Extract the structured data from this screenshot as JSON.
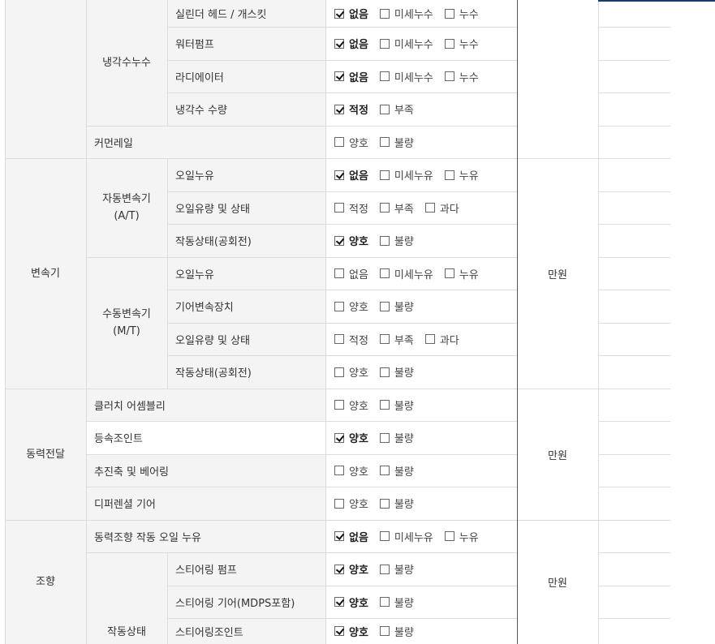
{
  "unit_label": "만원",
  "sections": [
    {
      "id": "engine-cont",
      "label": "",
      "unit": "",
      "subgroups": [
        {
          "label": "냉각수누수",
          "items": [
            {
              "label": "실린더 헤드 / 개스킷",
              "options": [
                "없음",
                "미세누수",
                "누수"
              ],
              "checked": [
                0
              ]
            },
            {
              "label": "워터펌프",
              "options": [
                "없음",
                "미세누수",
                "누수"
              ],
              "checked": [
                0
              ]
            },
            {
              "label": "라디에이터",
              "options": [
                "없음",
                "미세누수",
                "누수"
              ],
              "checked": [
                0
              ]
            },
            {
              "label": "냉각수 수량",
              "options": [
                "적정",
                "부족"
              ],
              "checked": [
                0
              ]
            }
          ]
        },
        {
          "label": "커먼레일",
          "single": true,
          "items": [
            {
              "label": "커먼레일",
              "options": [
                "양호",
                "불량"
              ],
              "checked": []
            }
          ]
        }
      ]
    },
    {
      "id": "transmission",
      "label": "변속기",
      "unit": "만원",
      "subgroups": [
        {
          "label": "자동변속기 (A/T)",
          "items": [
            {
              "label": "오일누유",
              "options": [
                "없음",
                "미세누유",
                "누유"
              ],
              "checked": [
                0
              ]
            },
            {
              "label": "오일유량 및 상태",
              "options": [
                "적정",
                "부족",
                "과다"
              ],
              "checked": []
            },
            {
              "label": "작동상태(공회전)",
              "options": [
                "양호",
                "불량"
              ],
              "checked": [
                0
              ]
            }
          ]
        },
        {
          "label": "수동변속기 (M/T)",
          "items": [
            {
              "label": "오일누유",
              "options": [
                "없음",
                "미세누유",
                "누유"
              ],
              "checked": []
            },
            {
              "label": "기어변속장치",
              "options": [
                "양호",
                "불량"
              ],
              "checked": []
            },
            {
              "label": "오일유량 및 상태",
              "options": [
                "적정",
                "부족",
                "과다"
              ],
              "checked": []
            },
            {
              "label": "작동상태(공회전)",
              "options": [
                "양호",
                "불량"
              ],
              "checked": []
            }
          ]
        }
      ]
    },
    {
      "id": "drivetrain",
      "label": "동력전달",
      "unit": "만원",
      "subgroups": [
        {
          "label": "클러치 어셈블리",
          "single": true,
          "items": [
            {
              "label": "클러치 어셈블리",
              "options": [
                "양호",
                "불량"
              ],
              "checked": []
            }
          ]
        },
        {
          "label": "등속조인트",
          "single": true,
          "items": [
            {
              "label": "등속조인트",
              "options": [
                "양호",
                "불량"
              ],
              "checked": [
                0
              ]
            }
          ]
        },
        {
          "label": "추진축 및 베어링",
          "single": true,
          "items": [
            {
              "label": "추진축 및 베어링",
              "options": [
                "양호",
                "불량"
              ],
              "checked": []
            }
          ]
        },
        {
          "label": "디퍼렌셜 기어",
          "single": true,
          "items": [
            {
              "label": "디퍼렌셜 기어",
              "options": [
                "양호",
                "불량"
              ],
              "checked": []
            }
          ]
        }
      ]
    },
    {
      "id": "steering",
      "label": "조향",
      "unit": "만원",
      "subgroups": [
        {
          "label": "동력조향 작동 오일 누유",
          "single": true,
          "items": [
            {
              "label": "동력조향 작동 오일 누유",
              "options": [
                "없음",
                "미세누유",
                "누유"
              ],
              "checked": [
                0
              ]
            }
          ]
        },
        {
          "label": "작동상태",
          "items": [
            {
              "label": "스티어링 펌프",
              "options": [
                "양호",
                "불량"
              ],
              "checked": [
                0
              ]
            },
            {
              "label": "스티어링 기어(MDPS포함)",
              "options": [
                "양호",
                "불량"
              ],
              "checked": [
                0
              ]
            },
            {
              "label": "스티어링조인트",
              "options": [
                "양호",
                "불량"
              ],
              "checked": [
                0
              ]
            }
          ]
        }
      ]
    }
  ]
}
